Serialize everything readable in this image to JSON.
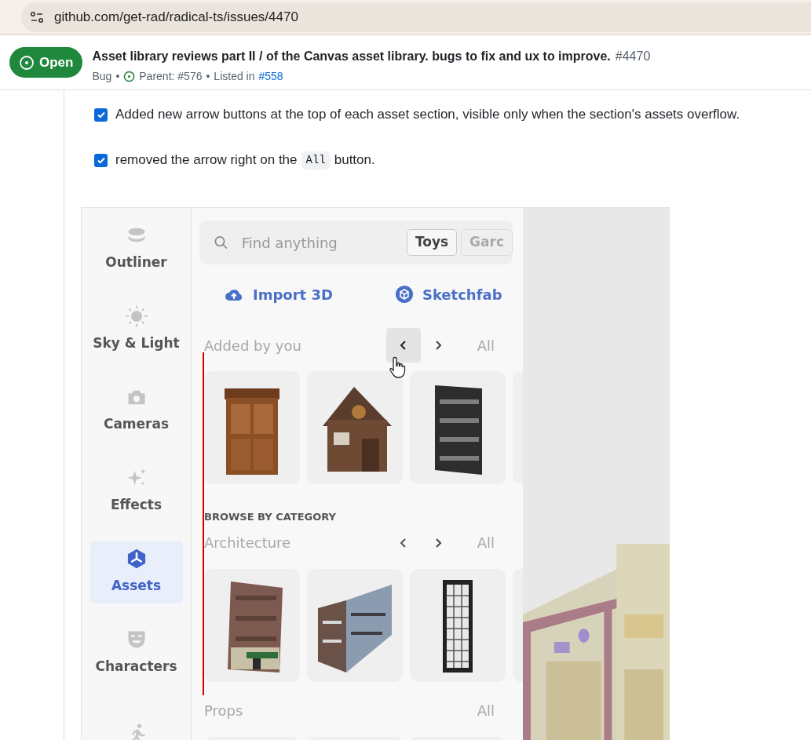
{
  "address_bar": {
    "url": "github.com/get-rad/radical-ts/issues/4470"
  },
  "issue": {
    "state": "Open",
    "title": "Asset library reviews part II / of the Canvas asset library. bugs to fix and ux to improve.",
    "number": "#4470",
    "type": "Bug",
    "parent": "Parent: #576",
    "separator": "•",
    "listed_in": "Listed in",
    "listed_in_link": "#558"
  },
  "tasks": [
    {
      "checked": true,
      "parts": [
        {
          "kind": "text",
          "text": "Added new arrow buttons at the top of each asset section, visible only when the section's assets overflow."
        }
      ]
    },
    {
      "checked": true,
      "parts": [
        {
          "kind": "text",
          "text": "removed the arrow right on the"
        },
        {
          "kind": "code",
          "text": "All"
        },
        {
          "kind": "text",
          "text": "button."
        }
      ]
    }
  ],
  "screenshot": {
    "sidebar": [
      {
        "label": "Outliner",
        "selected": false
      },
      {
        "label": "Sky & Light",
        "selected": false
      },
      {
        "label": "Cameras",
        "selected": false
      },
      {
        "label": "Effects",
        "selected": false
      },
      {
        "label": "Assets",
        "selected": true
      },
      {
        "label": "Characters",
        "selected": false
      },
      {
        "selected": false
      }
    ],
    "search": {
      "placeholder": "Find anything",
      "chips": [
        {
          "label": "Toys",
          "selected": true
        },
        {
          "label": "Garc",
          "selected": false
        }
      ]
    },
    "actions": [
      "Import 3D",
      "Sketchfab"
    ],
    "category_heading": "BROWSE BY CATEGORY",
    "sections": [
      {
        "title": "Added by you",
        "arrows": true,
        "prev_highlighted": true,
        "all": "All",
        "tiles": [
          {
            "kind": "door"
          },
          {
            "kind": "cabin"
          },
          {
            "kind": "shelf"
          },
          {
            "kind": "empty"
          }
        ]
      },
      {
        "title": "Architecture",
        "arrows": true,
        "prev_highlighted": false,
        "all": "All",
        "tiles": [
          {
            "kind": "building"
          },
          {
            "kind": "tower"
          },
          {
            "kind": "frame"
          },
          {
            "kind": "empty"
          }
        ]
      },
      {
        "title": "Props",
        "arrows": false,
        "all": "All",
        "tiles": [
          {
            "kind": "empty"
          },
          {
            "kind": "empty"
          },
          {
            "kind": "empty"
          }
        ]
      }
    ]
  }
}
